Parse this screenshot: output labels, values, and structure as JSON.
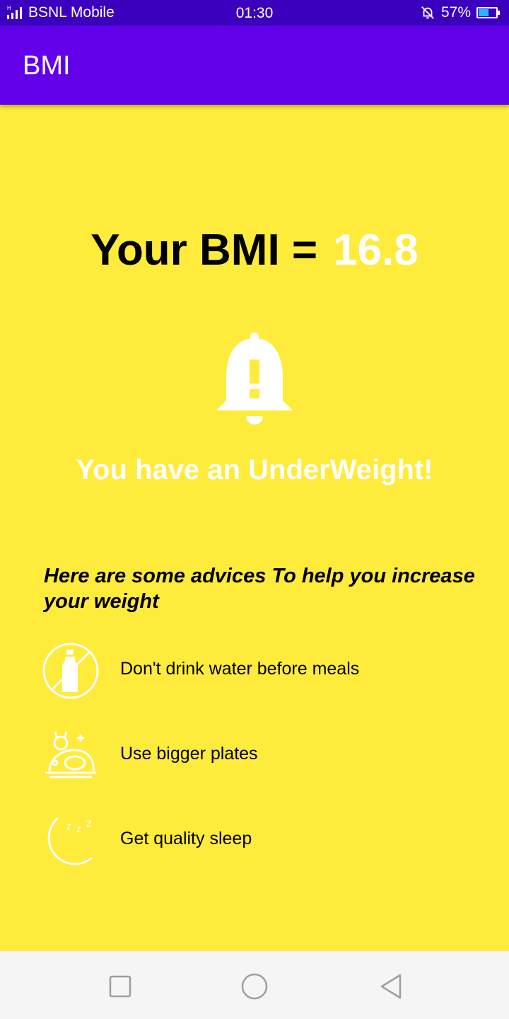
{
  "status_bar": {
    "carrier": "BSNL Mobile",
    "time": "01:30",
    "battery_percent": "57%",
    "battery_level": 0.57,
    "icons": [
      "signal-icon",
      "alarm-off-icon",
      "battery-icon"
    ]
  },
  "app_bar": {
    "title": "BMI"
  },
  "result": {
    "bmi_label": "Your BMI =",
    "bmi_value": "16.8",
    "status_message": "You have an UnderWeight!",
    "alert_icon": "bell-alert-icon"
  },
  "advice": {
    "heading": "Here are some advices To help you increase your weight",
    "items": [
      {
        "icon": "no-water-bottle-icon",
        "text": "Don't drink water before meals"
      },
      {
        "icon": "plate-food-icon",
        "text": "Use bigger plates"
      },
      {
        "icon": "moon-sleep-icon",
        "text": "Get quality sleep"
      }
    ]
  },
  "nav_bar": {
    "buttons": [
      "recents-square-icon",
      "home-circle-icon",
      "back-triangle-icon"
    ]
  },
  "colors": {
    "status_bar": "#3A00BD",
    "app_bar": "#6200EA",
    "background": "#FFEB3B",
    "highlight_text": "#FFFFFF",
    "nav_bar": "#F5F5F5"
  }
}
